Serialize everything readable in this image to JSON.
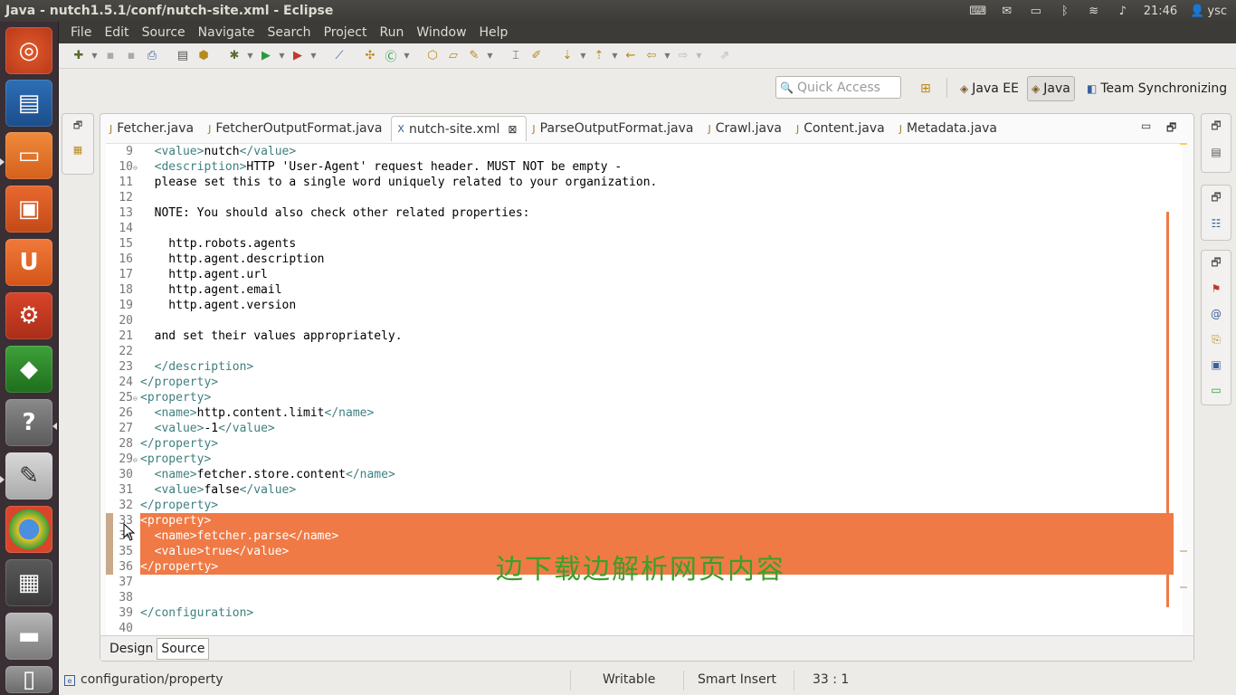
{
  "window_title": "Java - nutch1.5.1/conf/nutch-site.xml - Eclipse",
  "tray": {
    "time": "21:46",
    "user": "ysc",
    "icons": [
      "keyboard-icon",
      "mail-icon",
      "battery-icon",
      "bluetooth-icon",
      "wifi-icon",
      "volume-icon",
      "user-icon"
    ]
  },
  "launcher": {
    "items": [
      "ubuntu-dash",
      "libreoffice-writer",
      "files",
      "ubuntu-software-center",
      "ubuntu-one",
      "system-settings",
      "cube-app",
      "help",
      "text-editor",
      "chrome",
      "workspaces",
      "drive",
      "trash"
    ]
  },
  "menu": [
    "File",
    "Edit",
    "Source",
    "Navigate",
    "Search",
    "Project",
    "Run",
    "Window",
    "Help"
  ],
  "quick_access": {
    "placeholder": "Quick Access"
  },
  "perspectives": [
    {
      "label": "Java EE",
      "active": false
    },
    {
      "label": "Java",
      "active": true
    },
    {
      "label": "Team Synchronizing",
      "active": false
    }
  ],
  "tabs": [
    {
      "label": "Fetcher.java",
      "active": false
    },
    {
      "label": "FetcherOutputFormat.java",
      "active": false
    },
    {
      "label": "nutch-site.xml",
      "active": true
    },
    {
      "label": "ParseOutputFormat.java",
      "active": false
    },
    {
      "label": "Crawl.java",
      "active": false
    },
    {
      "label": "Content.java",
      "active": false
    },
    {
      "label": "Metadata.java",
      "active": false
    }
  ],
  "code_lines": [
    {
      "n": "9",
      "text": "  <value>nutch</value>",
      "hl": false,
      "fold": ""
    },
    {
      "n": "10",
      "text": "  <description>HTTP 'User-Agent' request header. MUST NOT be empty -",
      "hl": false,
      "fold": "⊖"
    },
    {
      "n": "11",
      "text": "  please set this to a single word uniquely related to your organization.",
      "hl": false,
      "fold": ""
    },
    {
      "n": "12",
      "text": "",
      "hl": false,
      "fold": ""
    },
    {
      "n": "13",
      "text": "  NOTE: You should also check other related properties:",
      "hl": false,
      "fold": ""
    },
    {
      "n": "14",
      "text": "",
      "hl": false,
      "fold": ""
    },
    {
      "n": "15",
      "text": "    http.robots.agents",
      "hl": false,
      "fold": ""
    },
    {
      "n": "16",
      "text": "    http.agent.description",
      "hl": false,
      "fold": ""
    },
    {
      "n": "17",
      "text": "    http.agent.url",
      "hl": false,
      "fold": ""
    },
    {
      "n": "18",
      "text": "    http.agent.email",
      "hl": false,
      "fold": ""
    },
    {
      "n": "19",
      "text": "    http.agent.version",
      "hl": false,
      "fold": ""
    },
    {
      "n": "20",
      "text": "",
      "hl": false,
      "fold": ""
    },
    {
      "n": "21",
      "text": "  and set their values appropriately.",
      "hl": false,
      "fold": ""
    },
    {
      "n": "22",
      "text": "",
      "hl": false,
      "fold": ""
    },
    {
      "n": "23",
      "text": "  </description>",
      "hl": false,
      "fold": ""
    },
    {
      "n": "24",
      "text": "</property>",
      "hl": false,
      "fold": ""
    },
    {
      "n": "25",
      "text": "<property>",
      "hl": false,
      "fold": "⊖"
    },
    {
      "n": "26",
      "text": "  <name>http.content.limit</name>",
      "hl": false,
      "fold": ""
    },
    {
      "n": "27",
      "text": "  <value>-1</value>",
      "hl": false,
      "fold": ""
    },
    {
      "n": "28",
      "text": "</property>",
      "hl": false,
      "fold": ""
    },
    {
      "n": "29",
      "text": "<property>",
      "hl": false,
      "fold": "⊖"
    },
    {
      "n": "30",
      "text": "  <name>fetcher.store.content</name>",
      "hl": false,
      "fold": ""
    },
    {
      "n": "31",
      "text": "  <value>false</value>",
      "hl": false,
      "fold": ""
    },
    {
      "n": "32",
      "text": "</property>",
      "hl": false,
      "fold": ""
    },
    {
      "n": "33",
      "text": "<property>",
      "hl": true,
      "fold": ""
    },
    {
      "n": "34",
      "text": "  <name>fetcher.parse</name>",
      "hl": true,
      "fold": ""
    },
    {
      "n": "35",
      "text": "  <value>true</value>",
      "hl": true,
      "fold": ""
    },
    {
      "n": "36",
      "text": "</property>",
      "hl": true,
      "fold": ""
    },
    {
      "n": "37",
      "text": "",
      "hl": false,
      "fold": ""
    },
    {
      "n": "38",
      "text": "",
      "hl": false,
      "fold": ""
    },
    {
      "n": "39",
      "text": "</configuration>",
      "hl": false,
      "fold": ""
    },
    {
      "n": "40",
      "text": "",
      "hl": false,
      "fold": ""
    }
  ],
  "overlay_text": "边下载边解析网页内容",
  "bottom_tabs": [
    {
      "label": "Design",
      "active": false
    },
    {
      "label": "Source",
      "active": true
    }
  ],
  "status": {
    "path": "configuration/property",
    "mode": "Writable",
    "insert": "Smart Insert",
    "position": "33 : 1"
  },
  "colors": {
    "highlight": "#ef7a45",
    "tag": "#3f7f7f",
    "overlay": "#3aa02a"
  }
}
